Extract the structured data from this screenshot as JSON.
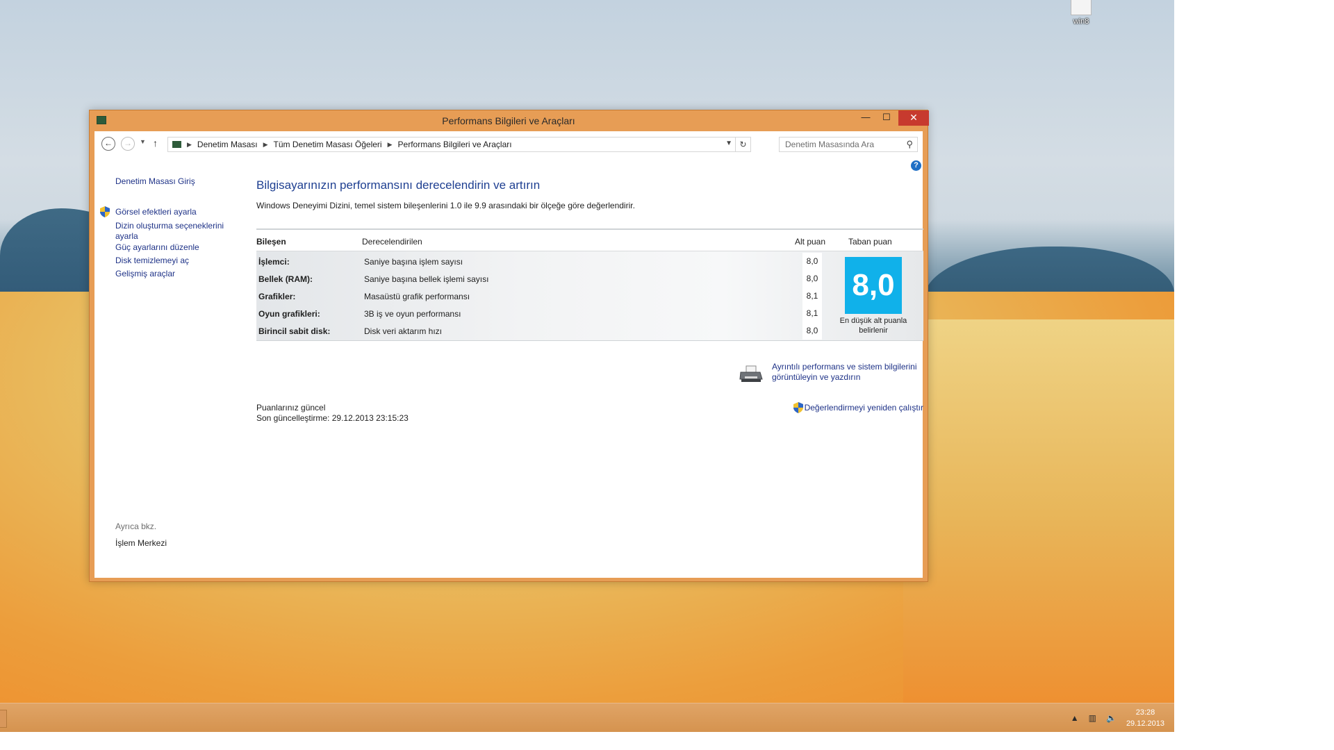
{
  "desktop": {
    "icon_label": "win8"
  },
  "window": {
    "title": "Performans Bilgileri ve Araçları",
    "controls": {
      "minimize": "—",
      "maximize": "☐",
      "close": "✕"
    }
  },
  "address_bar": {
    "crumbs": [
      "Denetim Masası",
      "Tüm Denetim Masası Öğeleri",
      "Performans Bilgileri ve Araçları"
    ],
    "search_placeholder": "Denetim Masasında Ara"
  },
  "sidebar": {
    "home": "Denetim Masası Giriş",
    "links": [
      "Görsel efektleri ayarla",
      "Dizin oluşturma seçeneklerini ayarla",
      "Güç ayarlarını düzenle",
      "Disk temizlemeyi aç",
      "Gelişmiş araçlar"
    ],
    "see_also_label": "Ayrıca bkz.",
    "see_also_link": "İşlem Merkezi"
  },
  "main": {
    "heading": "Bilgisayarınızın performansını derecelendirin ve artırın",
    "description": "Windows Deneyimi Dizini, temel sistem bileşenlerini 1.0 ile 9.9 arasındaki bir ölçeğe göre değerlendirir.",
    "columns": [
      "Bileşen",
      "Derecelendirilen",
      "Alt puan",
      "Taban puan"
    ],
    "rows": [
      {
        "component": "İşlemci:",
        "rated": "Saniye başına işlem sayısı",
        "subscore": "8,0"
      },
      {
        "component": "Bellek (RAM):",
        "rated": "Saniye başına bellek işlemi sayısı",
        "subscore": "8,0"
      },
      {
        "component": "Grafikler:",
        "rated": "Masaüstü grafik performansı",
        "subscore": "8,1"
      },
      {
        "component": "Oyun grafikleri:",
        "rated": "3B iş ve oyun performansı",
        "subscore": "8,1"
      },
      {
        "component": "Birincil sabit disk:",
        "rated": "Disk veri aktarım hızı",
        "subscore": "8,0"
      }
    ],
    "base_score": "8,0",
    "base_caption": "En düşük alt puanla belirlenir",
    "print_link": "Ayrıntılı performans ve sistem bilgilerini görüntüleyin ve yazdırın",
    "status_line1": "Puanlarınız güncel",
    "status_line2": "Son güncelleştirme: 29.12.2013 23:15:23",
    "rerun_link": "Değerlendirmeyi yeniden çalıştır"
  },
  "taskbar": {
    "time": "23:28",
    "date": "29.12.2013"
  }
}
